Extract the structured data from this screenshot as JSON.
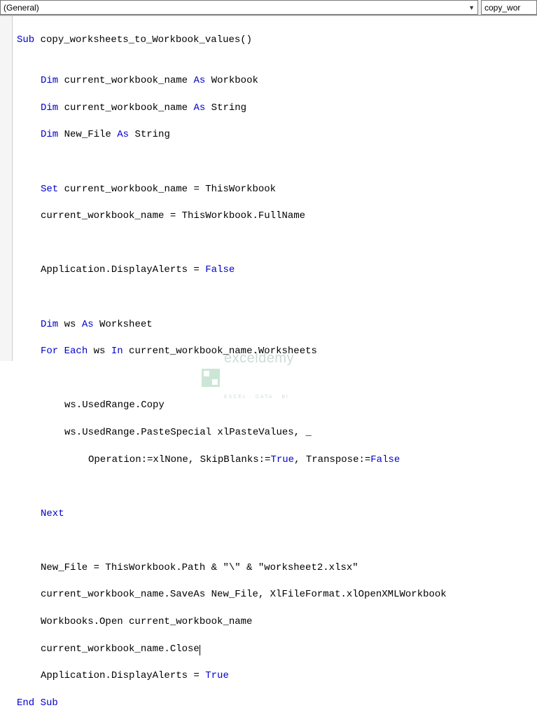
{
  "dropdowns": {
    "object": "(General)",
    "procedure": "copy_wor"
  },
  "code": {
    "l1_a": "Sub",
    "l1_b": " copy_worksheets_to_Workbook_values()",
    "l3_a": "Dim",
    "l3_b": " current_workbook_name ",
    "l3_c": "As",
    "l3_d": " Workbook",
    "l4_a": "Dim",
    "l4_b": " current_workbook_name ",
    "l4_c": "As",
    "l4_d": " String",
    "l5_a": "Dim",
    "l5_b": " New_File ",
    "l5_c": "As",
    "l5_d": " String",
    "l7_a": "Set",
    "l7_b": " current_workbook_name = ThisWorkbook",
    "l8": "current_workbook_name = ThisWorkbook.FullName",
    "l10_a": "Application.DisplayAlerts = ",
    "l10_b": "False",
    "l12_a": "Dim",
    "l12_b": " ws ",
    "l12_c": "As",
    "l12_d": " Worksheet",
    "l13_a": "For",
    "l13_b": " ",
    "l13_c": "Each",
    "l13_d": " ws ",
    "l13_e": "In",
    "l13_f": " current_workbook_name.Worksheets",
    "l15": "ws.UsedRange.Copy",
    "l16": "ws.UsedRange.PasteSpecial xlPasteValues, _",
    "l17_a": "Operation:=xlNone, SkipBlanks:=",
    "l17_b": "True",
    "l17_c": ", Transpose:=",
    "l17_d": "False",
    "l19": "Next",
    "l21": "New_File = ThisWorkbook.Path & \"\\\" & \"worksheet2.xlsx\"",
    "l22": "current_workbook_name.SaveAs New_File, XlFileFormat.xlOpenXMLWorkbook",
    "l23": "Workbooks.Open current_workbook_name",
    "l24": "current_workbook_name.Close",
    "l25_a": "Application.DisplayAlerts = ",
    "l25_b": "True",
    "l26": "End Sub"
  },
  "watermark": {
    "main": "exceldemy",
    "sub": "EXCEL · DATA · BI"
  }
}
